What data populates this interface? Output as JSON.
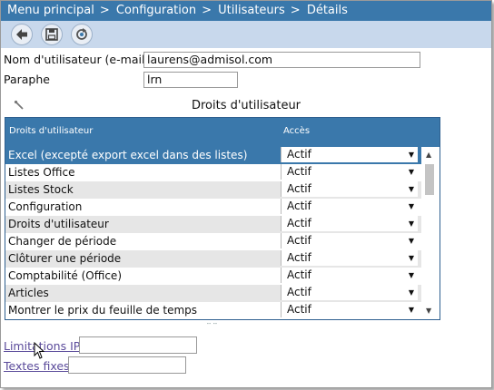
{
  "breadcrumb": [
    "Menu principal",
    "Configuration",
    "Utilisateurs",
    "Détails"
  ],
  "breadcrumb_separator": ">",
  "toolbar": {
    "buttons": [
      {
        "icon": "back-arrow-icon"
      },
      {
        "icon": "save-icon"
      },
      {
        "icon": "refresh-icon"
      }
    ]
  },
  "form": {
    "username_label": "Nom d'utilisateur (e-mail)",
    "username_value": "laurens@admisol.com",
    "paraphe_label": "Paraphe",
    "paraphe_value": "lrn"
  },
  "rights": {
    "section_title": "Droits d'utilisateur",
    "columns": [
      "Droits d'utilisateur",
      "Accès"
    ],
    "rows": [
      {
        "right": "Excel (excepté export excel dans des listes)",
        "access": "Actif"
      },
      {
        "right": "Listes Office",
        "access": "Actif"
      },
      {
        "right": "Listes Stock",
        "access": "Actif"
      },
      {
        "right": "Configuration",
        "access": "Actif"
      },
      {
        "right": "Droits d'utilisateur",
        "access": "Actif"
      },
      {
        "right": "Changer de période",
        "access": "Actif"
      },
      {
        "right": "Clôturer une période",
        "access": "Actif"
      },
      {
        "right": "Comptabilité (Office)",
        "access": "Actif"
      },
      {
        "right": "Articles",
        "access": "Actif"
      },
      {
        "right": "Montrer le prix du feuille de temps",
        "access": "Actif"
      }
    ],
    "dropdown_arrow": "▼"
  },
  "links": {
    "ip_limitations": "Limitations IP",
    "ip_limitations_value": "",
    "fixed_texts": "Textes fixes",
    "fixed_texts_value": ""
  },
  "colors": {
    "header_blue": "#3a78ab",
    "toolbar_bg": "#c8d8ec",
    "selected_row": "#3a78ab",
    "alt_row": "#e6e6e6"
  }
}
